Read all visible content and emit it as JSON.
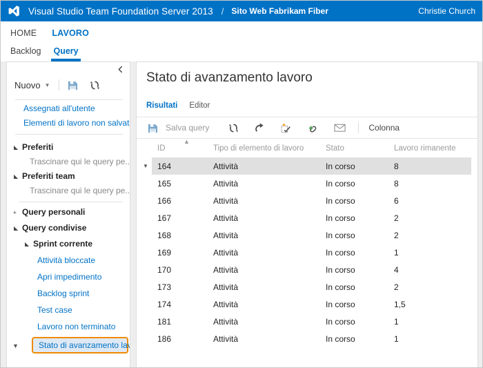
{
  "topbar": {
    "logo_icon": "visual-studio-logo-icon",
    "product": "Visual Studio Team Foundation Server 2013",
    "separator": "/",
    "project": "Sito Web Fabrikam Fiber",
    "user": "Christie Church",
    "background": "#0072c6"
  },
  "nav": {
    "level1": [
      {
        "label": "HOME",
        "active": false
      },
      {
        "label": "LAVORO",
        "active": true
      }
    ],
    "level2": [
      {
        "label": "Backlog",
        "active": false
      },
      {
        "label": "Query",
        "active": true
      }
    ],
    "accent": "#0072c6"
  },
  "sidebar": {
    "collapse_icon": "chevron-left-icon",
    "new_label": "Nuovo",
    "new_caret_icon": "chevron-down-icon",
    "save_icon": "save-icon",
    "refresh_icon": "refresh-icon",
    "links": [
      "Assegnati all'utente",
      "Elementi di lavoro non salvati"
    ],
    "tree": [
      {
        "label": "Preferiti",
        "expanded": true,
        "hint": "Trascinare qui le query pe..."
      },
      {
        "label": "Preferiti team",
        "expanded": true,
        "hint": "Trascinare qui le query pe..."
      },
      {
        "label": "Query personali",
        "expanded": false
      },
      {
        "label": "Query condivise",
        "expanded": true
      }
    ],
    "folder": {
      "label": "Sprint corrente",
      "expanded": true
    },
    "queries": [
      "Attività bloccate",
      "Apri impedimento",
      "Backlog sprint",
      "Test case",
      "Lavoro non terminato"
    ],
    "selected_query": "Stato di avanzamento lavoro",
    "selected_highlight": "#f08a00",
    "scroll_down_icon": "caret-down-icon"
  },
  "content": {
    "title": "Stato di avanzamento lavoro",
    "tabs": [
      {
        "label": "Risultati",
        "active": true
      },
      {
        "label": "Editor",
        "active": false
      }
    ],
    "toolbar": {
      "save_icon": "save-icon",
      "save_query_label": "Salva query",
      "refresh_icon": "refresh-icon",
      "revert_icon": "redo-arrow-icon",
      "new_workitem_icon": "new-work-item-icon",
      "add_link_icon": "add-link-icon",
      "email_icon": "envelope-icon",
      "column_label": "Colonna"
    },
    "grid": {
      "sort_icon": "sort-ascending-icon",
      "row_caret_icon": "caret-down-icon",
      "columns": [
        "ID",
        "Tipo di elemento di lavoro",
        "Stato",
        "Lavoro rimanente"
      ],
      "rows": [
        {
          "id": "164",
          "type": "Attività",
          "state": "In corso",
          "remaining": "8",
          "selected": true
        },
        {
          "id": "165",
          "type": "Attività",
          "state": "In corso",
          "remaining": "8",
          "selected": false
        },
        {
          "id": "166",
          "type": "Attività",
          "state": "In corso",
          "remaining": "6",
          "selected": false
        },
        {
          "id": "167",
          "type": "Attività",
          "state": "In corso",
          "remaining": "2",
          "selected": false
        },
        {
          "id": "168",
          "type": "Attività",
          "state": "In corso",
          "remaining": "2",
          "selected": false
        },
        {
          "id": "169",
          "type": "Attività",
          "state": "In corso",
          "remaining": "1",
          "selected": false
        },
        {
          "id": "170",
          "type": "Attività",
          "state": "In corso",
          "remaining": "4",
          "selected": false
        },
        {
          "id": "173",
          "type": "Attività",
          "state": "In corso",
          "remaining": "2",
          "selected": false
        },
        {
          "id": "174",
          "type": "Attività",
          "state": "In corso",
          "remaining": "1,5",
          "selected": false
        },
        {
          "id": "181",
          "type": "Attività",
          "state": "In corso",
          "remaining": "1",
          "selected": false
        },
        {
          "id": "186",
          "type": "Attività",
          "state": "In corso",
          "remaining": "1",
          "selected": false
        }
      ]
    }
  }
}
